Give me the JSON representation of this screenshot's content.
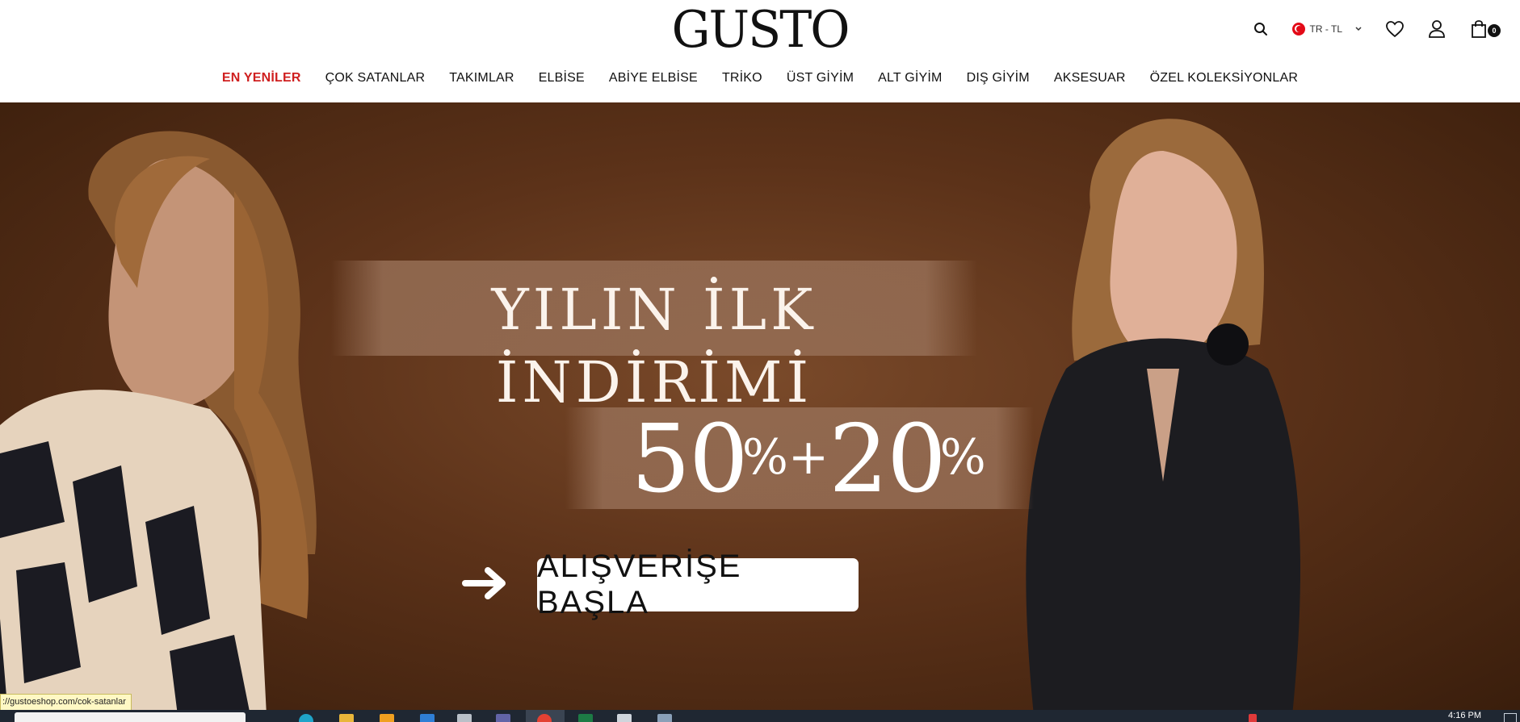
{
  "header": {
    "logo": "GUSTO",
    "language": "TR - TL",
    "cart_count": "0",
    "icons": [
      "search-icon",
      "flag-icon",
      "chevron-down-icon",
      "heart-icon",
      "user-icon",
      "shopping-bag-icon"
    ]
  },
  "nav": {
    "items": [
      {
        "label": "EN YENİLER",
        "active": true
      },
      {
        "label": "ÇOK SATANLAR"
      },
      {
        "label": "TAKIMLAR"
      },
      {
        "label": "ELBİSE"
      },
      {
        "label": "ABİYE ELBİSE"
      },
      {
        "label": "TRİKO"
      },
      {
        "label": "ÜST GİYİM"
      },
      {
        "label": "ALT GİYİM"
      },
      {
        "label": "DIŞ GİYİM"
      },
      {
        "label": "AKSESUAR"
      },
      {
        "label": "ÖZEL KOLEKSİYONLAR"
      }
    ]
  },
  "hero": {
    "headline": "YILIN İLK İNDİRİMİ",
    "discount_first": "50",
    "discount_second": "20",
    "percent": "%",
    "plus": "+",
    "cta": "ALIŞVERİŞE BAŞLA"
  },
  "status_bar": {
    "url": "://gustoeshop.com/cok-satanlar"
  },
  "taskbar": {
    "time": "4:16 PM"
  },
  "colors": {
    "nav_active": "#cf1f1f",
    "hero_background": "#5c3219"
  }
}
